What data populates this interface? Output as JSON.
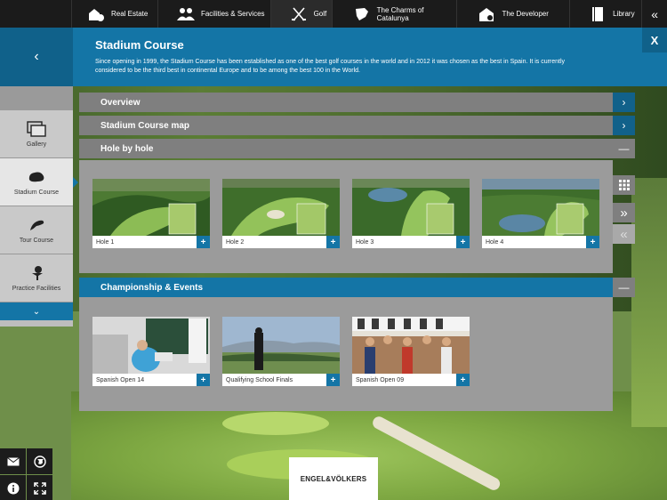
{
  "nav": {
    "items": [
      {
        "label": "Real Estate",
        "icon": "house-person-icon"
      },
      {
        "label": "Facilities & Services",
        "icon": "people-icon"
      },
      {
        "label": "Golf",
        "icon": "golf-clubs-icon"
      },
      {
        "label": "The Charms of Catalunya",
        "icon": "catalunya-map-icon"
      },
      {
        "label": "The Developer",
        "icon": "developer-icon"
      },
      {
        "label": "Library",
        "icon": "book-icon"
      }
    ],
    "collapse": "«"
  },
  "header": {
    "back": "‹",
    "title": "Stadium Course",
    "description": "Since opening in 1999, the Stadium Course has been established as one of the best golf courses in the world and in 2012 it was chosen as the best in Spain. It is currently considered to be the third best in continental Europe and to be among the best 100 in the World.",
    "close": "X"
  },
  "sidebar": {
    "items": [
      {
        "label": "Gallery",
        "icon": "gallery-icon"
      },
      {
        "label": "Stadium Course",
        "icon": "course-shape-icon"
      },
      {
        "label": "Tour Course",
        "icon": "course-shape-icon"
      },
      {
        "label": "Practice Facilities",
        "icon": "golf-tee-icon"
      }
    ],
    "more": "⌄"
  },
  "sections": {
    "overview": "Overview",
    "course_map": "Stadium Course map",
    "hole_by_hole": "Hole by hole",
    "championship": "Championship & Events"
  },
  "holes": [
    "Hole 1",
    "Hole 2",
    "Hole 3",
    "Hole 4"
  ],
  "events": [
    "Spanish Open 14",
    "Qualifying School Finals",
    "Spanish Open 09"
  ],
  "controls": {
    "arrow": "›",
    "minus": "—",
    "plus": "+",
    "next": "»",
    "prev": "«"
  },
  "tools": [
    "✉",
    "🌐",
    "i",
    "⤢"
  ],
  "logo": "ENGEL&VÖLKERS",
  "colors": {
    "accent": "#1475a6",
    "dark": "#1b1b1b",
    "bar": "#7f7f7f"
  }
}
